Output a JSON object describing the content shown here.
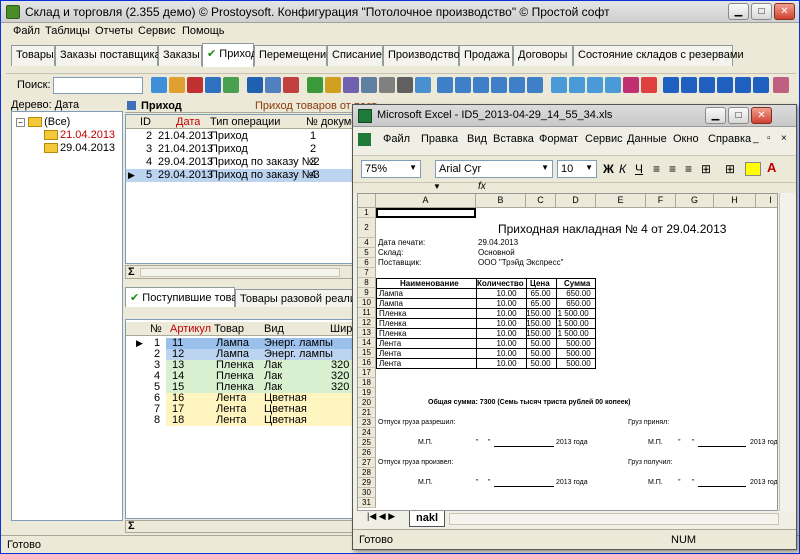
{
  "app": {
    "title": "Склад и торговля (2.355 демо) © Prostoysoft. Конфигурация \"Потолочное производство\" © Простой софт",
    "menu": [
      "Файл",
      "Таблицы",
      "Отчеты",
      "Сервис",
      "Помощь"
    ],
    "tabs": [
      "Товары",
      "Заказы поставщикам",
      "Заказы",
      "Приход",
      "Перемещение",
      "Списание",
      "Производство",
      "Продажа",
      "Договоры",
      "Состояние складов с резервами"
    ],
    "active_tab": "Приход",
    "check_mark": "✔",
    "search_label": "Поиск:",
    "search_value": "",
    "status": "Готово"
  },
  "tree": {
    "label": "Дерево: Дата",
    "root": "(Все)",
    "nodes": [
      "21.04.2013",
      "29.04.2013"
    ]
  },
  "prihod": {
    "header": "Приход",
    "description": "Приход товаров от пост",
    "columns": [
      "ID",
      "Дата",
      "Тип операции",
      "№ документ"
    ],
    "rows": [
      {
        "id": "2",
        "date": "21.04.2013",
        "type": "Приход",
        "num": "1"
      },
      {
        "id": "3",
        "date": "21.04.2013",
        "type": "Приход",
        "num": "2"
      },
      {
        "id": "4",
        "date": "29.04.2013",
        "type": "Приход по заказу №2",
        "num": "3"
      },
      {
        "id": "5",
        "date": "29.04.2013",
        "type": "Приход по заказу №3",
        "num": "4"
      }
    ],
    "sum_symbol": "Σ"
  },
  "detail": {
    "tabs": [
      "Поступившие товары",
      "Товары разовой реализации"
    ],
    "columns": [
      "№",
      "Артикул",
      "Товар",
      "Вид",
      "Шири"
    ],
    "rows": [
      {
        "n": "1",
        "art": "11",
        "name": "Лампа",
        "kind": "Энерг. лампы",
        "w": ""
      },
      {
        "n": "2",
        "art": "12",
        "name": "Лампа",
        "kind": "Энерг. лампы",
        "w": ""
      },
      {
        "n": "3",
        "art": "13",
        "name": "Пленка",
        "kind": "Лак",
        "w": "320"
      },
      {
        "n": "4",
        "art": "14",
        "name": "Пленка",
        "kind": "Лак",
        "w": "320"
      },
      {
        "n": "5",
        "art": "15",
        "name": "Пленка",
        "kind": "Лак",
        "w": "320"
      },
      {
        "n": "6",
        "art": "16",
        "name": "Лента",
        "kind": "Цветная",
        "w": ""
      },
      {
        "n": "7",
        "art": "17",
        "name": "Лента",
        "kind": "Цветная",
        "w": ""
      },
      {
        "n": "8",
        "art": "18",
        "name": "Лента",
        "kind": "Цветная",
        "w": ""
      }
    ],
    "sum_symbol": "Σ"
  },
  "excel": {
    "title": "Microsoft Excel - ID5_2013-04-29_14_55_34.xls",
    "menu": [
      "Файл",
      "Правка",
      "Вид",
      "Вставка",
      "Формат",
      "Сервис",
      "Данные",
      "Окно",
      "Справка"
    ],
    "zoom": "75%",
    "font": "Arial Cyr",
    "size": "10",
    "fx": "fx",
    "columns": [
      "A",
      "B",
      "C",
      "D",
      "E",
      "F",
      "G",
      "H",
      "I"
    ],
    "sheet_tab": "nakl",
    "status": "Готово",
    "num": "NUM",
    "doc": {
      "title": "Приходная накладная № 4 от 29.04.2013",
      "print_date_label": "Дата печати:",
      "print_date": "29.04.2013",
      "warehouse_label": "Склад:",
      "warehouse": "Основной",
      "supplier_label": "Поставщик:",
      "supplier": "ООО \"Трэйд Экспресс\"",
      "headers": [
        "Наименование",
        "Количество",
        "Цена",
        "Сумма"
      ],
      "items": [
        {
          "name": "Лампа",
          "qty": "10.00",
          "price": "65.00",
          "sum": "650.00"
        },
        {
          "name": "Лампа",
          "qty": "10.00",
          "price": "65.00",
          "sum": "650.00"
        },
        {
          "name": "Пленка",
          "qty": "10.00",
          "price": "150.00",
          "sum": "1 500.00"
        },
        {
          "name": "Пленка",
          "qty": "10.00",
          "price": "150.00",
          "sum": "1 500.00"
        },
        {
          "name": "Пленка",
          "qty": "10.00",
          "price": "150.00",
          "sum": "1 500.00"
        },
        {
          "name": "Лента",
          "qty": "10.00",
          "price": "50.00",
          "sum": "500.00"
        },
        {
          "name": "Лента",
          "qty": "10.00",
          "price": "50.00",
          "sum": "500.00"
        },
        {
          "name": "Лента",
          "qty": "10.00",
          "price": "50.00",
          "sum": "500.00"
        }
      ],
      "total": "Общая сумма: 7300 (Семь тысяч триста рублей 00 копеек)",
      "release_allowed": "Отпуск груза разрешил:",
      "cargo_accepted": "Груз принял:",
      "released": "Отпуск груза произвел:",
      "received": "Груз получил:",
      "mp": "М.П.",
      "quote": "\"",
      "year": "2013 года",
      "year_short": "2013 год"
    }
  }
}
